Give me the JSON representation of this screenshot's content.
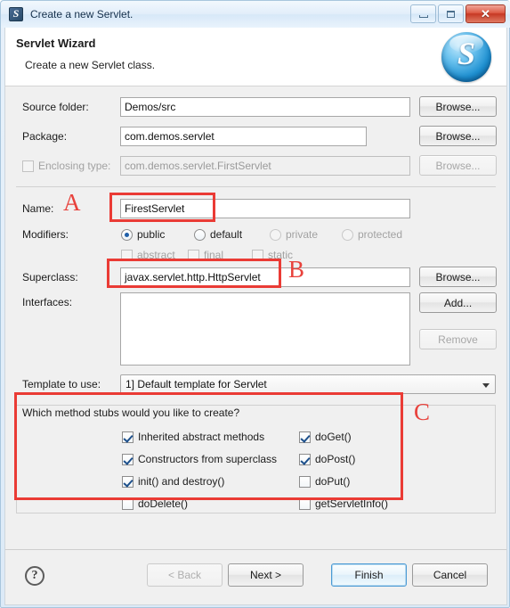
{
  "window": {
    "title": "Create a new Servlet.",
    "app_icon": "servlet-icon",
    "minimize_label": "Minimize",
    "maximize_label": "Maximize",
    "close_label": "Close"
  },
  "banner": {
    "title": "Servlet Wizard",
    "subtitle": "Create a new Servlet class.",
    "logo_letter": "S"
  },
  "form": {
    "source_folder": {
      "label": "Source folder:",
      "value": "Demos/src",
      "browse": "Browse..."
    },
    "package": {
      "label": "Package:",
      "value": "com.demos.servlet",
      "browse": "Browse..."
    },
    "enclosing_type": {
      "label": "Enclosing type:",
      "value": "com.demos.servlet.FirstServlet",
      "browse": "Browse...",
      "checked": false,
      "enabled": false
    },
    "name": {
      "label": "Name:",
      "value": "FirestServlet"
    },
    "modifiers": {
      "label": "Modifiers:",
      "radios": [
        {
          "label": "public",
          "checked": true,
          "enabled": true
        },
        {
          "label": "default",
          "checked": false,
          "enabled": true
        },
        {
          "label": "private",
          "checked": false,
          "enabled": false
        },
        {
          "label": "protected",
          "checked": false,
          "enabled": false
        }
      ],
      "checks": [
        {
          "label": "abstract",
          "checked": false,
          "enabled": false
        },
        {
          "label": "final",
          "checked": false,
          "enabled": false
        },
        {
          "label": "static",
          "checked": false,
          "enabled": false
        }
      ]
    },
    "superclass": {
      "label": "Superclass:",
      "value": "javax.servlet.http.HttpServlet",
      "browse": "Browse..."
    },
    "interfaces": {
      "label": "Interfaces:",
      "items": [],
      "add": "Add...",
      "remove": "Remove"
    },
    "template": {
      "label": "Template to use:",
      "value": "1] Default template for Servlet"
    },
    "method_stubs": {
      "title": "Which method stubs would you like to create?",
      "left_column": [
        {
          "label": "Inherited abstract methods",
          "checked": true
        },
        {
          "label": "Constructors from superclass",
          "checked": true
        },
        {
          "label": "init() and destroy()",
          "checked": true
        },
        {
          "label": "doDelete()",
          "checked": false
        }
      ],
      "right_column": [
        {
          "label": "doGet()",
          "checked": true
        },
        {
          "label": "doPost()",
          "checked": true
        },
        {
          "label": "doPut()",
          "checked": false
        },
        {
          "label": "getServletInfo()",
          "checked": false
        }
      ]
    }
  },
  "annotations": {
    "a": "A",
    "b": "B",
    "c": "C",
    "color": "#ea3b35"
  },
  "footer": {
    "help": "?",
    "back": "< Back",
    "next": "Next >",
    "finish": "Finish",
    "cancel": "Cancel"
  }
}
